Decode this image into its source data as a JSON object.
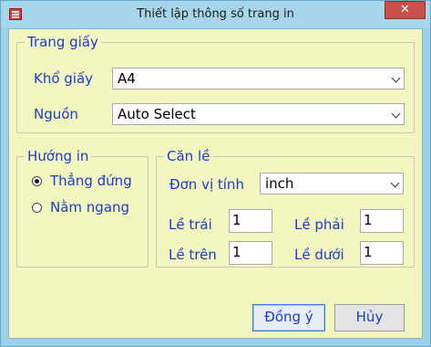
{
  "window": {
    "title": "Thiết lập thông số trang in",
    "close_label": "✕"
  },
  "paper": {
    "group_title": "Trang giấy",
    "size_label": "Khổ giấy",
    "size_value": "A4",
    "source_label": "Nguồn",
    "source_value": "Auto Select"
  },
  "orientation": {
    "group_title": "Hướng in",
    "portrait_label": "Thẳng đứng",
    "landscape_label": "Nằm ngang",
    "selected": "portrait"
  },
  "margins": {
    "group_title": "Căn lề",
    "unit_label": "Đơn vị tính",
    "unit_value": "inch",
    "left_label": "Lề trái",
    "left_value": "1",
    "right_label": "Lề phải",
    "right_value": "1",
    "top_label": "Lề trên",
    "top_value": "1",
    "bottom_label": "Lề dưới",
    "bottom_value": "1"
  },
  "buttons": {
    "ok_label": "Đồng ý",
    "cancel_label": "Hủy"
  },
  "colors": {
    "label_text": "#1a3cc8",
    "client_bg": "#f4f6c2",
    "title_bar": "#a7d6ec",
    "close_button": "#c7504a"
  }
}
